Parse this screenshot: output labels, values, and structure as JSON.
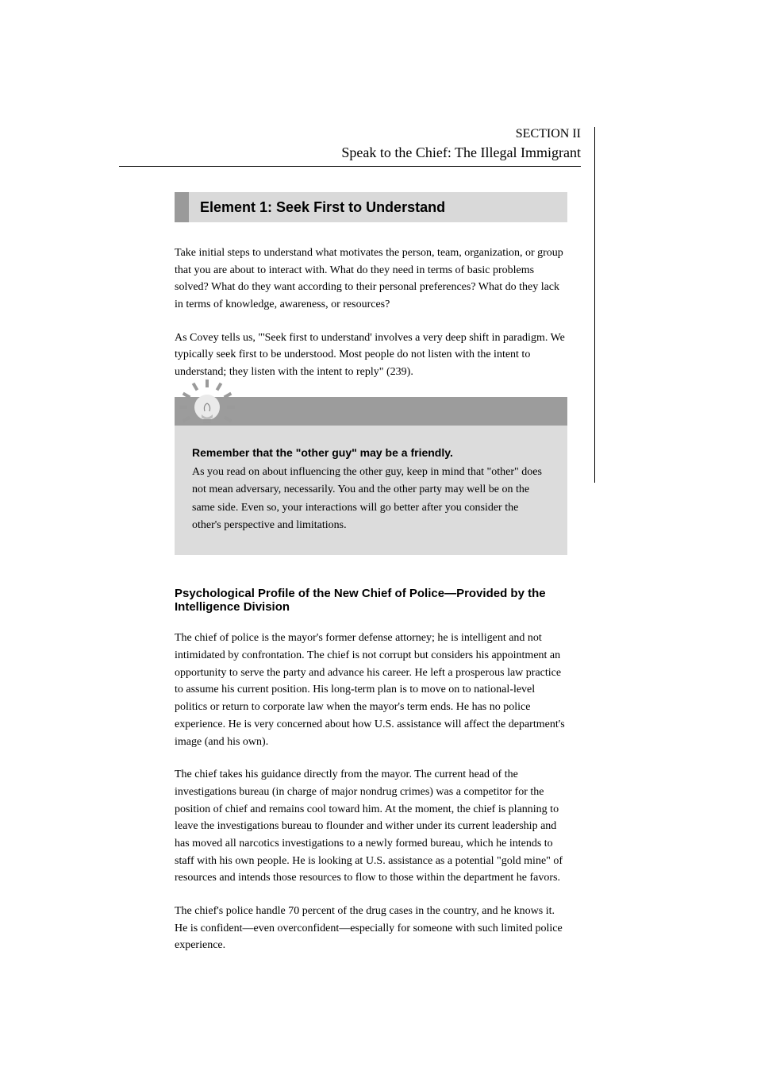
{
  "header": {
    "section_small": "SECTION II",
    "section_title": "Speak to the Chief: The Illegal Immigrant"
  },
  "section_bar": {
    "title": "Element 1: Seek First to Understand"
  },
  "paragraphs": [
    "Take initial steps to understand what motivates the person, team, organization, or group that you are about to interact with. What do they need in terms of basic problems solved? What do they want according to their personal preferences? What do they lack in terms of knowledge, awareness, or resources?",
    "As Covey tells us, \"'Seek first to understand' involves a very deep shift in paradigm. We typically seek first to be understood. Most people do not listen with the intent to understand; they listen with the intent to reply\" (239)."
  ],
  "callout": {
    "title": "Remember that the \"other guy\" may be a friendly.",
    "body": "As you read on about influencing the other guy, keep in mind that \"other\" does not mean adversary, necessarily. You and the other party may well be on the same side. Even so, your interactions will go better after you consider the other's perspective and limitations."
  },
  "inset": {
    "heading": "Psychological Profile of the New Chief of Police—Provided by the Intelligence Division",
    "paragraphs": [
      "The chief of police is the mayor's former defense attorney; he is intelligent and not intimidated by confrontation. The chief is not corrupt but considers his appointment an opportunity to serve the party and advance his career. He left a prosperous law practice to assume his current position. His long-term plan is to move on to national-level politics or return to corporate law when the mayor's term ends. He has no police experience. He is very concerned about how U.S. assistance will affect the department's image (and his own).",
      "The chief takes his guidance directly from the mayor. The current head of the investigations bureau (in charge of major nondrug crimes) was a competitor for the position of chief and remains cool toward him. At the moment, the chief is planning to leave the investigations bureau to flounder and wither under its current leadership and has moved all narcotics investigations to a newly formed bureau, which he intends to staff with his own people. He is looking at U.S. assistance as a potential \"gold mine\" of resources and intends those resources to flow to those within the department he favors.",
      "The chief's police handle 70 percent of the drug cases in the country, and he knows it. He is confident—even overconfident—especially for someone with such limited police experience."
    ]
  }
}
